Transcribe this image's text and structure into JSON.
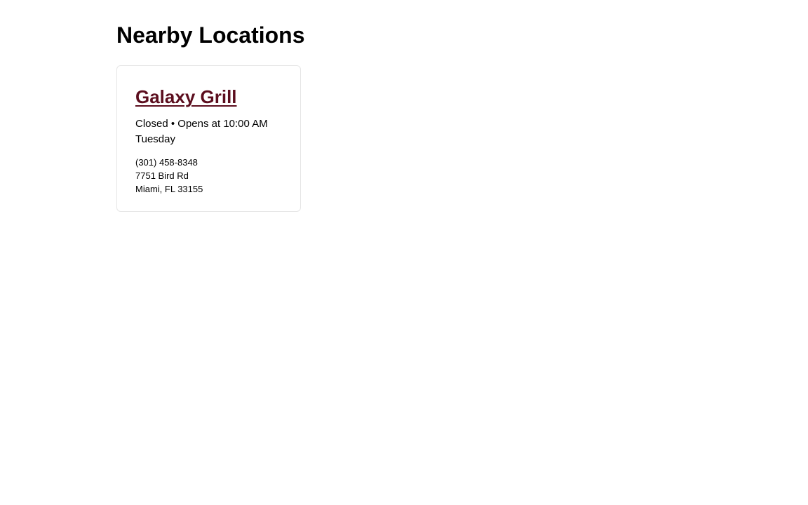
{
  "page": {
    "title": "Nearby Locations"
  },
  "locations": [
    {
      "name": "Galaxy Grill",
      "status": "Closed • Opens at 10:00 AM Tuesday",
      "phone": "(301) 458-8348",
      "address_line1": "7751 Bird Rd",
      "address_line2": "Miami, FL 33155"
    }
  ],
  "colors": {
    "link": "#5c0e1e",
    "card_border": "#e6e6e6"
  }
}
